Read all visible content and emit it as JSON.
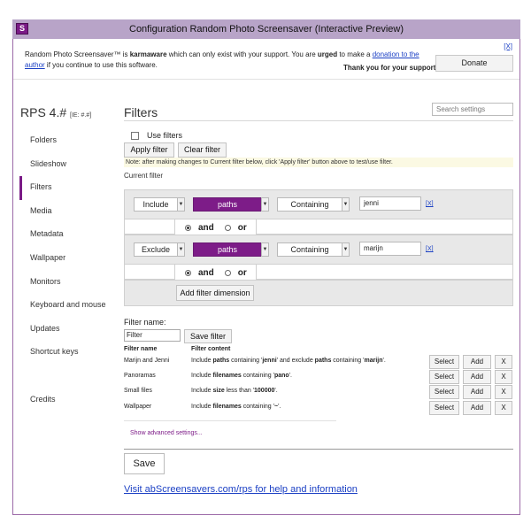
{
  "window": {
    "title": "Configuration Random Photo Screensaver (Interactive Preview)",
    "app_icon": "S"
  },
  "notice": {
    "part1": "Random Photo Screensaver™ is ",
    "karmaware": "karmaware",
    "part2": " which can only exist with your support. You are ",
    "urged": "urged",
    "part3": " to make a ",
    "link": "donation to the author",
    "part4": " if you continue to use this software.",
    "thanks": "Thank you for your support!",
    "donate_label": "Donate",
    "close_label": "[X]"
  },
  "brand": {
    "name": "RPS 4.#",
    "version": "[IE: #.#]"
  },
  "nav": [
    {
      "label": "Folders",
      "active": false
    },
    {
      "label": "Slideshow",
      "active": false
    },
    {
      "label": "Filters",
      "active": true
    },
    {
      "label": "Media",
      "active": false
    },
    {
      "label": "Metadata",
      "active": false
    },
    {
      "label": "Wallpaper",
      "active": false
    },
    {
      "label": "Monitors",
      "active": false
    },
    {
      "label": "Keyboard and mouse",
      "active": false
    },
    {
      "label": "Updates",
      "active": false
    },
    {
      "label": "Shortcut keys",
      "active": false
    },
    {
      "label": "",
      "active": false
    },
    {
      "label": "Credits",
      "active": false
    }
  ],
  "page": {
    "title": "Filters",
    "search_placeholder": "Search settings",
    "use_filters_label": "Use filters",
    "apply_filter_label": "Apply filter",
    "clear_filter_label": "Clear filter",
    "note": "Note: after making changes to Current filter below, click 'Apply filter' button above to test/use filter.",
    "current_filter_label": "Current filter"
  },
  "filter_rows": [
    {
      "mode": "Include",
      "field": "paths",
      "op": "Containing",
      "value": "jenni",
      "remove": "[X]"
    },
    {
      "mode": "Exclude",
      "field": "paths",
      "op": "Containing",
      "value": "marijn",
      "remove": "[X]"
    }
  ],
  "logic": {
    "and_label": "and",
    "or_label": "or"
  },
  "add_dimension_label": "Add filter dimension",
  "saved": {
    "name_label": "Filter name:",
    "name_value": "Filter",
    "save_filter_label": "Save filter",
    "col_name": "Filter name",
    "col_content": "Filter content",
    "rows": [
      {
        "name": "Marijn and Jenni",
        "c1": "Include ",
        "b1": "paths",
        "c2": " containing '",
        "b2": "jenni",
        "c3": "' and exclude ",
        "b3": "paths",
        "c4": " containing '",
        "b4": "marijn",
        "c5": "'."
      },
      {
        "name": "Panoramas",
        "c1": "Include ",
        "b1": "filenames",
        "c2": " containing '",
        "b2": "pano",
        "c3": "'.",
        "b3": "",
        "c4": "",
        "b4": "",
        "c5": ""
      },
      {
        "name": "Small files",
        "c1": "Include ",
        "b1": "size",
        "c2": " less than '",
        "b2": "100000",
        "c3": "'.",
        "b3": "",
        "c4": "",
        "b4": "",
        "c5": ""
      },
      {
        "name": "Wallpaper",
        "c1": "Include ",
        "b1": "filenames",
        "c2": " containing '",
        "b2": "~",
        "c3": "'.",
        "b3": "",
        "c4": "",
        "b4": "",
        "c5": ""
      }
    ],
    "select_label": "Select",
    "add_label": "Add",
    "delete_label": "X"
  },
  "advanced_label": "Show advanced settings...",
  "save_label": "Save",
  "visit_label": "Visit abScreensavers.com/rps for help and information",
  "colors": {
    "accent": "#7d1c88",
    "titlebar": "#b8a4c8",
    "link": "#1a3fc4"
  }
}
